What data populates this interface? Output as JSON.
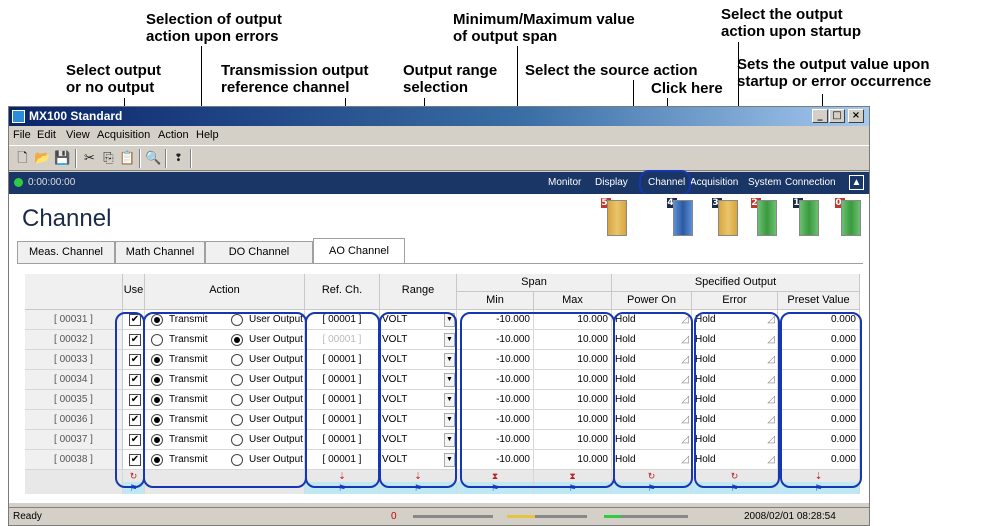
{
  "callouts": {
    "selection_errors": "Selection of output\naction upon errors",
    "select_output": "Select output\nor no output",
    "ref_channel": "Transmission output\nreference channel",
    "range_selection": "Output range\nselection",
    "min_max": "Minimum/Maximum value\nof output span",
    "source_action": "Select the source action",
    "click_here": "Click here",
    "startup_action": "Select the output\naction upon startup",
    "output_value": "Sets the output value upon\nstartup or error occurrence"
  },
  "window": {
    "title": "MX100 Standard",
    "controls": [
      "_",
      "□",
      "×"
    ],
    "menu": [
      "File",
      "Edit",
      "View",
      "Acquisition",
      "Action",
      "Help"
    ]
  },
  "navbar": {
    "time": "0:00:00:00",
    "items": [
      "Monitor",
      "Display",
      "Channel",
      "Acquisition",
      "System",
      "Connection"
    ],
    "active": "Channel"
  },
  "page": {
    "title": "Channel",
    "modules": [
      {
        "num": "5",
        "color": "#c0392b"
      },
      {
        "num": "4",
        "color": "#1a2a4a"
      },
      {
        "num": "3",
        "color": "#1a2a4a"
      },
      {
        "num": "2",
        "color": "#c0392b"
      },
      {
        "num": "1",
        "color": "#1a2a4a"
      },
      {
        "num": "0",
        "color": "#c0392b"
      }
    ],
    "tabs": [
      "Meas. Channel",
      "Math Channel",
      "DO Channel",
      "AO Channel"
    ],
    "active_tab": "AO Channel"
  },
  "grid": {
    "headers": {
      "use": "Use",
      "action": "Action",
      "ref_ch": "Ref. Ch.",
      "range": "Range",
      "span": "Span",
      "min": "Min",
      "max": "Max",
      "specified_output": "Specified Output",
      "power_on": "Power On",
      "error": "Error",
      "preset_value": "Preset Value"
    },
    "rows": [
      {
        "ch": "[ 00031 ]",
        "transmit": true,
        "ref": "[ 00001 ]",
        "range": "VOLT",
        "min": "-10.000",
        "max": "10.000",
        "power": "Hold",
        "error": "Hold",
        "preset": "0.000"
      },
      {
        "ch": "[ 00032 ]",
        "transmit": false,
        "ref": "[ 00001 ]",
        "range": "VOLT",
        "min": "-10.000",
        "max": "10.000",
        "power": "Hold",
        "error": "Hold",
        "preset": "0.000"
      },
      {
        "ch": "[ 00033 ]",
        "transmit": true,
        "ref": "[ 00001 ]",
        "range": "VOLT",
        "min": "-10.000",
        "max": "10.000",
        "power": "Hold",
        "error": "Hold",
        "preset": "0.000"
      },
      {
        "ch": "[ 00034 ]",
        "transmit": true,
        "ref": "[ 00001 ]",
        "range": "VOLT",
        "min": "-10.000",
        "max": "10.000",
        "power": "Hold",
        "error": "Hold",
        "preset": "0.000"
      },
      {
        "ch": "[ 00035 ]",
        "transmit": true,
        "ref": "[ 00001 ]",
        "range": "VOLT",
        "min": "-10.000",
        "max": "10.000",
        "power": "Hold",
        "error": "Hold",
        "preset": "0.000"
      },
      {
        "ch": "[ 00036 ]",
        "transmit": true,
        "ref": "[ 00001 ]",
        "range": "VOLT",
        "min": "-10.000",
        "max": "10.000",
        "power": "Hold",
        "error": "Hold",
        "preset": "0.000"
      },
      {
        "ch": "[ 00037 ]",
        "transmit": true,
        "ref": "[ 00001 ]",
        "range": "VOLT",
        "min": "-10.000",
        "max": "10.000",
        "power": "Hold",
        "error": "Hold",
        "preset": "0.000"
      },
      {
        "ch": "[ 00038 ]",
        "transmit": true,
        "ref": "[ 00001 ]",
        "range": "VOLT",
        "min": "-10.000",
        "max": "10.000",
        "power": "Hold",
        "error": "Hold",
        "preset": "0.000"
      }
    ],
    "transmit_label": "Transmit",
    "user_output_label": "User Output"
  },
  "status": {
    "text": "Ready",
    "counter": "0",
    "datetime": "2008/02/01 08:28:54"
  },
  "colors": {
    "highlight": "#1637b0",
    "navbar": "#1a3666",
    "titlebar": "#0a246a"
  }
}
